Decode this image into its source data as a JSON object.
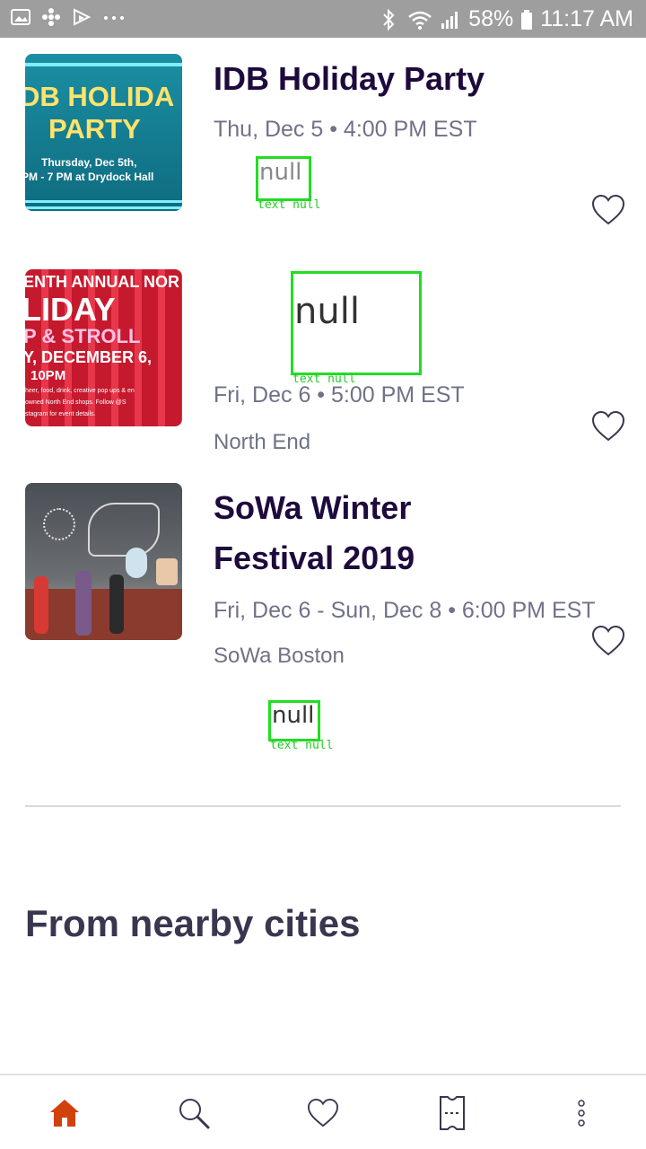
{
  "status_bar": {
    "battery": "58%",
    "time": "11:17 AM",
    "icons": [
      "gallery-icon",
      "fan-icon",
      "cast-icon",
      "more-dots-icon",
      "bluetooth-icon",
      "wifi-icon",
      "signal-icon",
      "battery-icon"
    ]
  },
  "events": [
    {
      "title": "IDB Holiday Party",
      "date": "Thu, Dec 5 • 4:00 PM EST",
      "venue": "",
      "thumb_lines": [
        "DB HOLIDA",
        "PARTY",
        "Thursday, Dec 5th,",
        "PM - 7 PM at Drydock Hall"
      ],
      "null_text": "null",
      "null_caption": "text null"
    },
    {
      "title": "",
      "date": "Fri, Dec 6 • 5:00 PM EST",
      "venue": "North End",
      "thumb_lines": [
        "ENTH ANNUAL NOR",
        "LIDAY",
        "P & STROLL",
        "Y, DECEMBER 6,",
        "10PM",
        "heer, food, drink, creative pop ups & en",
        "owned North End shops. Follow @S",
        "stagram for event details."
      ],
      "null_text": "null",
      "null_caption": "text null"
    },
    {
      "title_line1": "SoWa Winter",
      "title_line2": "Festival 2019",
      "date": "Fri, Dec 6 - Sun, Dec 8 • 6:00 PM EST",
      "venue": "SoWa Boston",
      "null_text": "null",
      "null_caption": "text null"
    }
  ],
  "section": {
    "title": "From nearby cities"
  },
  "bottom_nav": {
    "items": [
      "home-icon",
      "search-icon",
      "heart-icon",
      "ticket-icon",
      "more-vertical-icon"
    ],
    "active_color": "#d1410c",
    "inactive_color": "#39364f"
  }
}
